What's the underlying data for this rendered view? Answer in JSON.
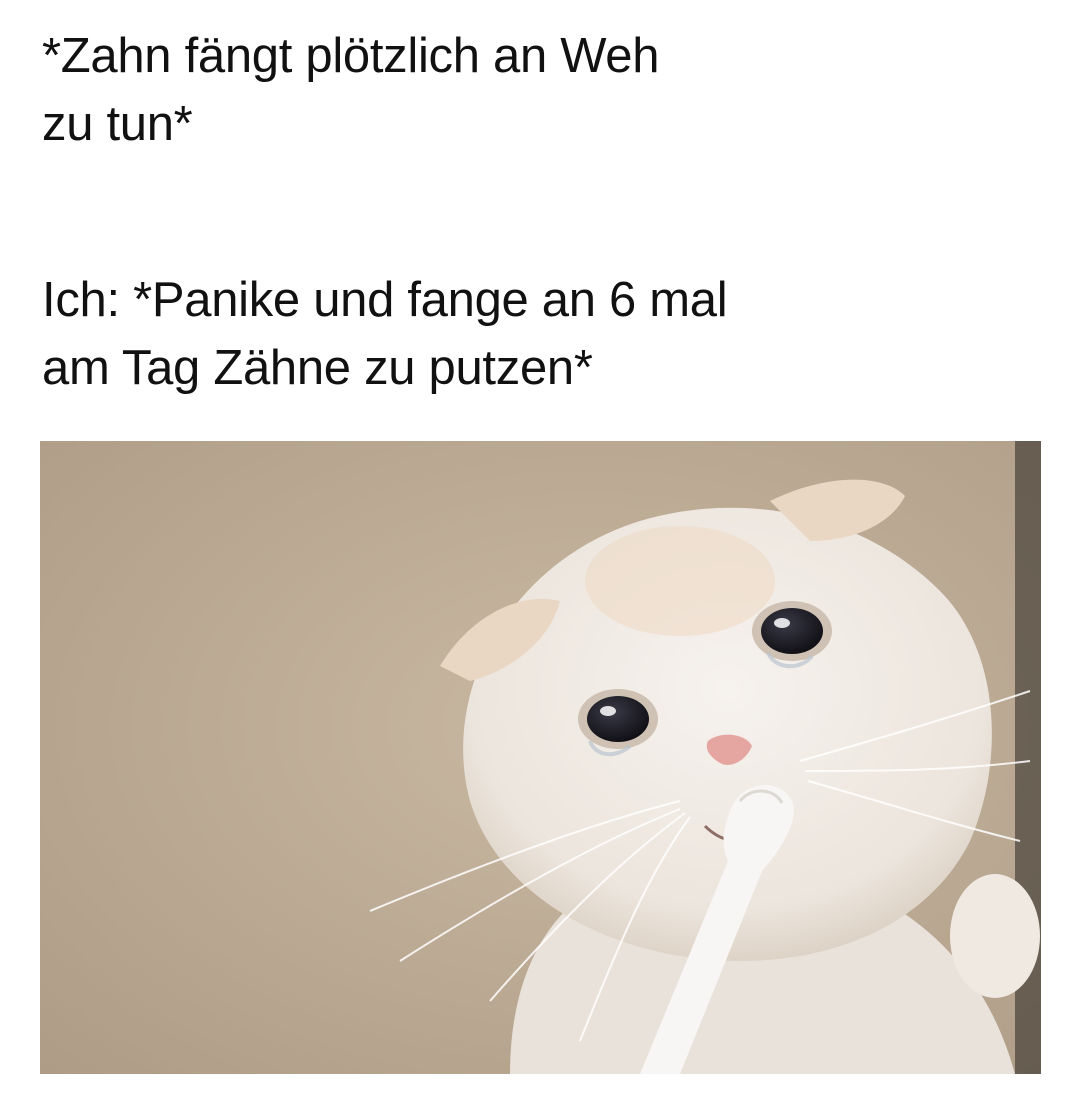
{
  "meme": {
    "caption_1": {
      "line_1": "*Zahn fängt plötzlich an Weh",
      "line_2": "zu tun*"
    },
    "caption_2": {
      "line_1": "Ich: *Panike und fange an 6 mal",
      "line_2": "am Tag Zähne zu putzen*"
    },
    "image": {
      "subject": "crying white cat with toothbrush",
      "colors": {
        "background_wall": "#bfae98",
        "fur": "#f1ece6",
        "fur_shadow": "#d9cfc4",
        "ear_tint": "#ecd6c0",
        "nose": "#e7a9a4",
        "eye": "#1c1b22",
        "toothbrush": "#f7f6f4"
      }
    }
  }
}
